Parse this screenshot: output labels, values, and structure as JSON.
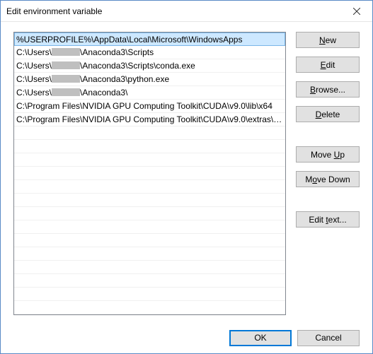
{
  "title": "Edit environment variable",
  "paths": [
    {
      "text": "%USERPROFILE%\\AppData\\Local\\Microsoft\\WindowsApps",
      "selected": true,
      "redacted": false
    },
    {
      "prefix": "C:\\Users\\",
      "suffix": "\\Anaconda3\\Scripts",
      "redacted": true
    },
    {
      "prefix": "C:\\Users\\",
      "suffix": "\\Anaconda3\\Scripts\\conda.exe",
      "redacted": true
    },
    {
      "prefix": "C:\\Users\\",
      "suffix": "\\Anaconda3\\python.exe",
      "redacted": true
    },
    {
      "prefix": "C:\\Users\\",
      "suffix": "\\Anaconda3\\",
      "redacted": true
    },
    {
      "text": "C:\\Program Files\\NVIDIA GPU Computing Toolkit\\CUDA\\v9.0\\lib\\x64",
      "redacted": false
    },
    {
      "text": "C:\\Program Files\\NVIDIA GPU Computing Toolkit\\CUDA\\v9.0\\extras\\C...",
      "redacted": false
    }
  ],
  "buttons": {
    "new": "New",
    "edit": "Edit",
    "browse": "Browse...",
    "delete": "Delete",
    "moveup": "Move Up",
    "movedown": "Move Down",
    "edittext": "Edit text...",
    "ok": "OK",
    "cancel": "Cancel"
  }
}
